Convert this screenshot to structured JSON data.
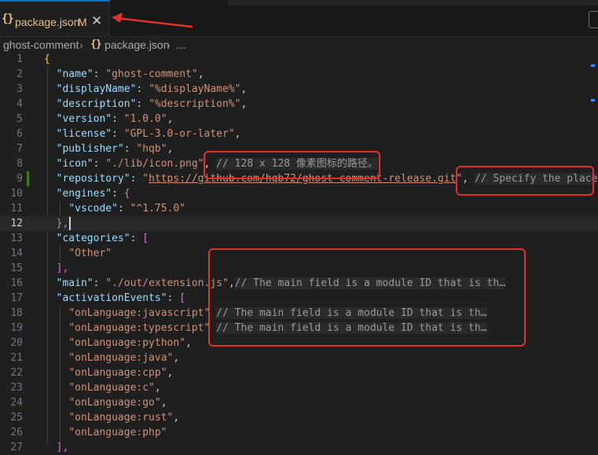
{
  "tab": {
    "icon": "{}",
    "label": "package.json",
    "status": "M",
    "close": "✕"
  },
  "breadcrumb": {
    "folder": "ghost-comment",
    "sep": "›",
    "file_icon": "{}",
    "file": "package.json",
    "ellipsis": "…"
  },
  "editor": {
    "active_line": 12,
    "lines": [
      {
        "n": "1"
      },
      {
        "n": "2"
      },
      {
        "n": "3"
      },
      {
        "n": "4"
      },
      {
        "n": "5"
      },
      {
        "n": "6"
      },
      {
        "n": "7"
      },
      {
        "n": "8"
      },
      {
        "n": "9"
      },
      {
        "n": "10"
      },
      {
        "n": "11"
      },
      {
        "n": "12"
      },
      {
        "n": "13"
      },
      {
        "n": "14"
      },
      {
        "n": "15"
      },
      {
        "n": "16"
      },
      {
        "n": "17"
      },
      {
        "n": "18"
      },
      {
        "n": "19"
      },
      {
        "n": "20"
      },
      {
        "n": "21"
      },
      {
        "n": "22"
      },
      {
        "n": "23"
      },
      {
        "n": "24"
      },
      {
        "n": "25"
      },
      {
        "n": "26"
      },
      {
        "n": "27"
      }
    ],
    "code": {
      "l1": "{",
      "l2_key": "\"name\"",
      "l2_val": "\"ghost-comment\"",
      "l3_key": "\"displayName\"",
      "l3_val": "\"%displayName%\"",
      "l4_key": "\"description\"",
      "l4_val": "\"%description%\"",
      "l5_key": "\"version\"",
      "l5_val": "\"1.0.0\"",
      "l6_key": "\"license\"",
      "l6_val": "\"GPL-3.0-or-later\"",
      "l7_key": "\"publisher\"",
      "l7_val": "\"hqb\"",
      "l8_key": "\"icon\"",
      "l8_val": "\"./lib/icon.png\"",
      "l8_hint": "// 128 x 128 像素图标的路径。",
      "l9_key": "\"repository\"",
      "l9_q1": "\"",
      "l9_url": "https://github.com/hqb72/ghost-comment-release.git",
      "l9_q2": "\"",
      "l9_hint": "// Specify the place",
      "l10_key": "\"engines\"",
      "l10_brace": "{",
      "l11_key": "\"vscode\"",
      "l11_val": "\"^1.75.0\"",
      "l12": "},",
      "l13_key": "\"categories\"",
      "l13_bracket": "[",
      "l14_val": "\"Other\"",
      "l15": "],",
      "l16_key": "\"main\"",
      "l16_val": "\"./out/extension.js\"",
      "l16_hint": "// The main field is a module ID that is th…",
      "l17_key": "\"activationEvents\"",
      "l17_bracket": "[",
      "l18_val": "\"onLanguage:javascript\"",
      "l18_hint": "// The main field is a module ID that is th…",
      "l19_val": "\"onLanguage:typescript\"",
      "l19_hint": "// The main field is a module ID that is th…",
      "l20_val": "\"onLanguage:python\"",
      "l21_val": "\"onLanguage:java\"",
      "l22_val": "\"onLanguage:cpp\"",
      "l23_val": "\"onLanguage:c\"",
      "l24_val": "\"onLanguage:go\"",
      "l25_val": "\"onLanguage:rust\"",
      "l26_val": "\"onLanguage:php\"",
      "l27": "],"
    }
  },
  "colors": {
    "annotation_red": "#e0312a",
    "accent_blue": "#0078d4",
    "modified_tab": "#e2c08d"
  }
}
